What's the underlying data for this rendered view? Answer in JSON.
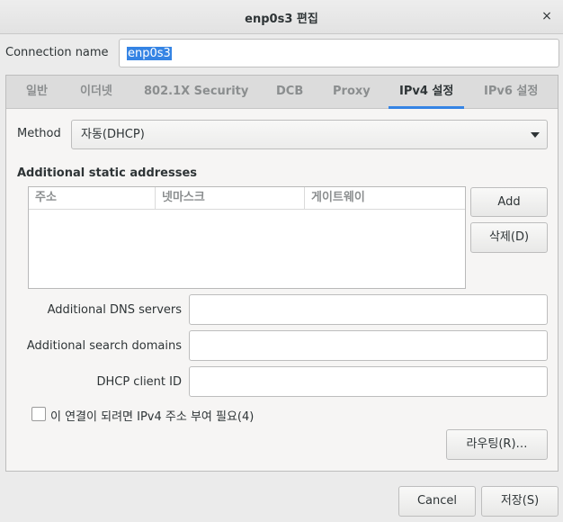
{
  "window": {
    "title": "enp0s3 편집",
    "close_symbol": "×"
  },
  "connection": {
    "label": "Connection name",
    "value": "enp0s3"
  },
  "tabs": [
    {
      "label": "일반"
    },
    {
      "label": "이더넷"
    },
    {
      "label": "802.1X Security"
    },
    {
      "label": "DCB"
    },
    {
      "label": "Proxy"
    },
    {
      "label": "IPv4 설정",
      "active": true
    },
    {
      "label": "IPv6 설정"
    }
  ],
  "ipv4": {
    "method_label": "Method",
    "method_value": "자동(DHCP)",
    "addresses_heading": "Additional static addresses",
    "columns": [
      "주소",
      "넷마스크",
      "게이트웨이"
    ],
    "add_button": "Add",
    "delete_button": "삭제(D)",
    "dns_label": "Additional DNS servers",
    "dns_value": "",
    "search_label": "Additional search domains",
    "search_value": "",
    "dhcp_id_label": "DHCP client ID",
    "dhcp_id_value": "",
    "require_label": "이 연결이 되려면 IPv4 주소 부여 필요(4)",
    "require_checked": false,
    "routes_button": "라우팅(R)…"
  },
  "footer": {
    "cancel_button": "Cancel",
    "save_button": "저장(S)"
  },
  "colors": {
    "accent": "#3584e4",
    "selection": "#3584e4"
  }
}
